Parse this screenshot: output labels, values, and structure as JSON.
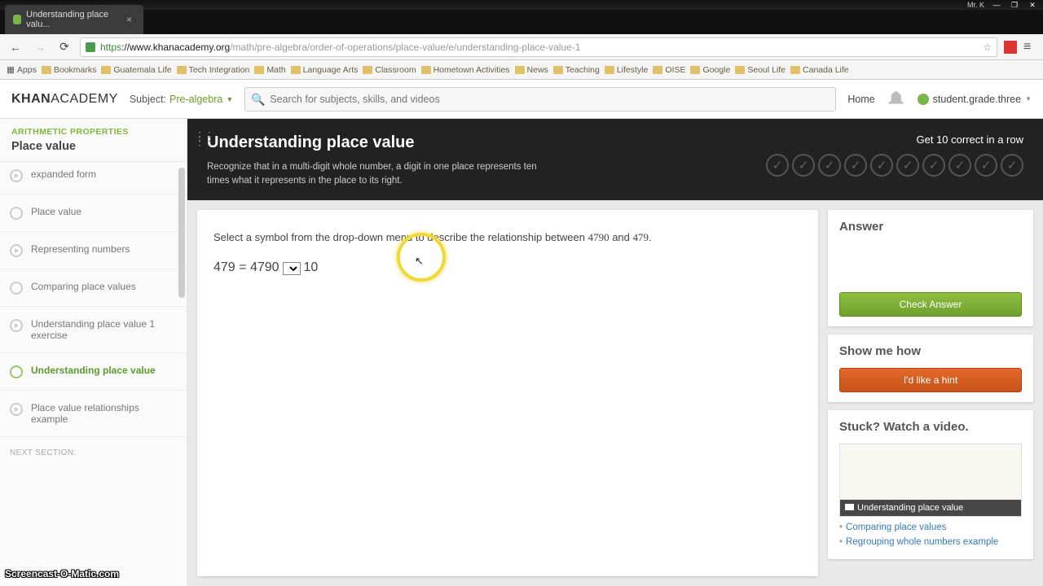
{
  "os": {
    "user": "Mr. K"
  },
  "tab": {
    "title": "Understanding place valu..."
  },
  "url": {
    "proto": "https",
    "host": "://www.khanacademy.org",
    "path": "/math/pre-algebra/order-of-operations/place-value/e/understanding-place-value-1"
  },
  "bookmarks": [
    "Apps",
    "Bookmarks",
    "Guatemala Life",
    "Tech Integration",
    "Math",
    "Language Arts",
    "Classroom",
    "Hometown Activities",
    "News",
    "Teaching",
    "Lifestyle",
    "OISE",
    "Google",
    "Seoul Life",
    "Canada Life"
  ],
  "kh": {
    "subject_label": "Subject:",
    "subject": "Pre-algebra",
    "search_placeholder": "Search for subjects, skills, and videos",
    "home": "Home",
    "user": "student.grade.three"
  },
  "sidebar": {
    "crumb": "ARITHMETIC PROPERTIES",
    "section": "Place value",
    "items": [
      {
        "label": "expanded form",
        "play": true
      },
      {
        "label": "Place value"
      },
      {
        "label": "Representing numbers",
        "play": true
      },
      {
        "label": "Comparing place values"
      },
      {
        "label": "Understanding place value 1 exercise",
        "play": true
      },
      {
        "label": "Understanding place value",
        "active": true
      },
      {
        "label": "Place value relationships example",
        "play": true
      }
    ],
    "next": "NEXT SECTION:"
  },
  "page": {
    "title": "Understanding place value",
    "sub": "Recognize that in a multi-digit whole number, a digit in one place represents ten times what it represents in the place to its right.",
    "streak": "Get 10 correct in a row"
  },
  "q": {
    "prefix": "Select a symbol from the drop-down menu to describe the relationship between ",
    "n1": "4790",
    "mid": " and ",
    "n2": "479",
    "suffix": ".",
    "eq_a": "479",
    "eq_eq": " = ",
    "eq_b": "4790",
    "eq_c": " 10"
  },
  "rhs": {
    "answer": "Answer",
    "check": "Check Answer",
    "show": "Show me how",
    "hint": "I'd like a hint",
    "stuck": "Stuck? Watch a video.",
    "vtitle": "Understanding place value",
    "link1": "Comparing place values",
    "link2": "Regrouping whole numbers example"
  },
  "watermark": "Screencast-O-Matic.com"
}
